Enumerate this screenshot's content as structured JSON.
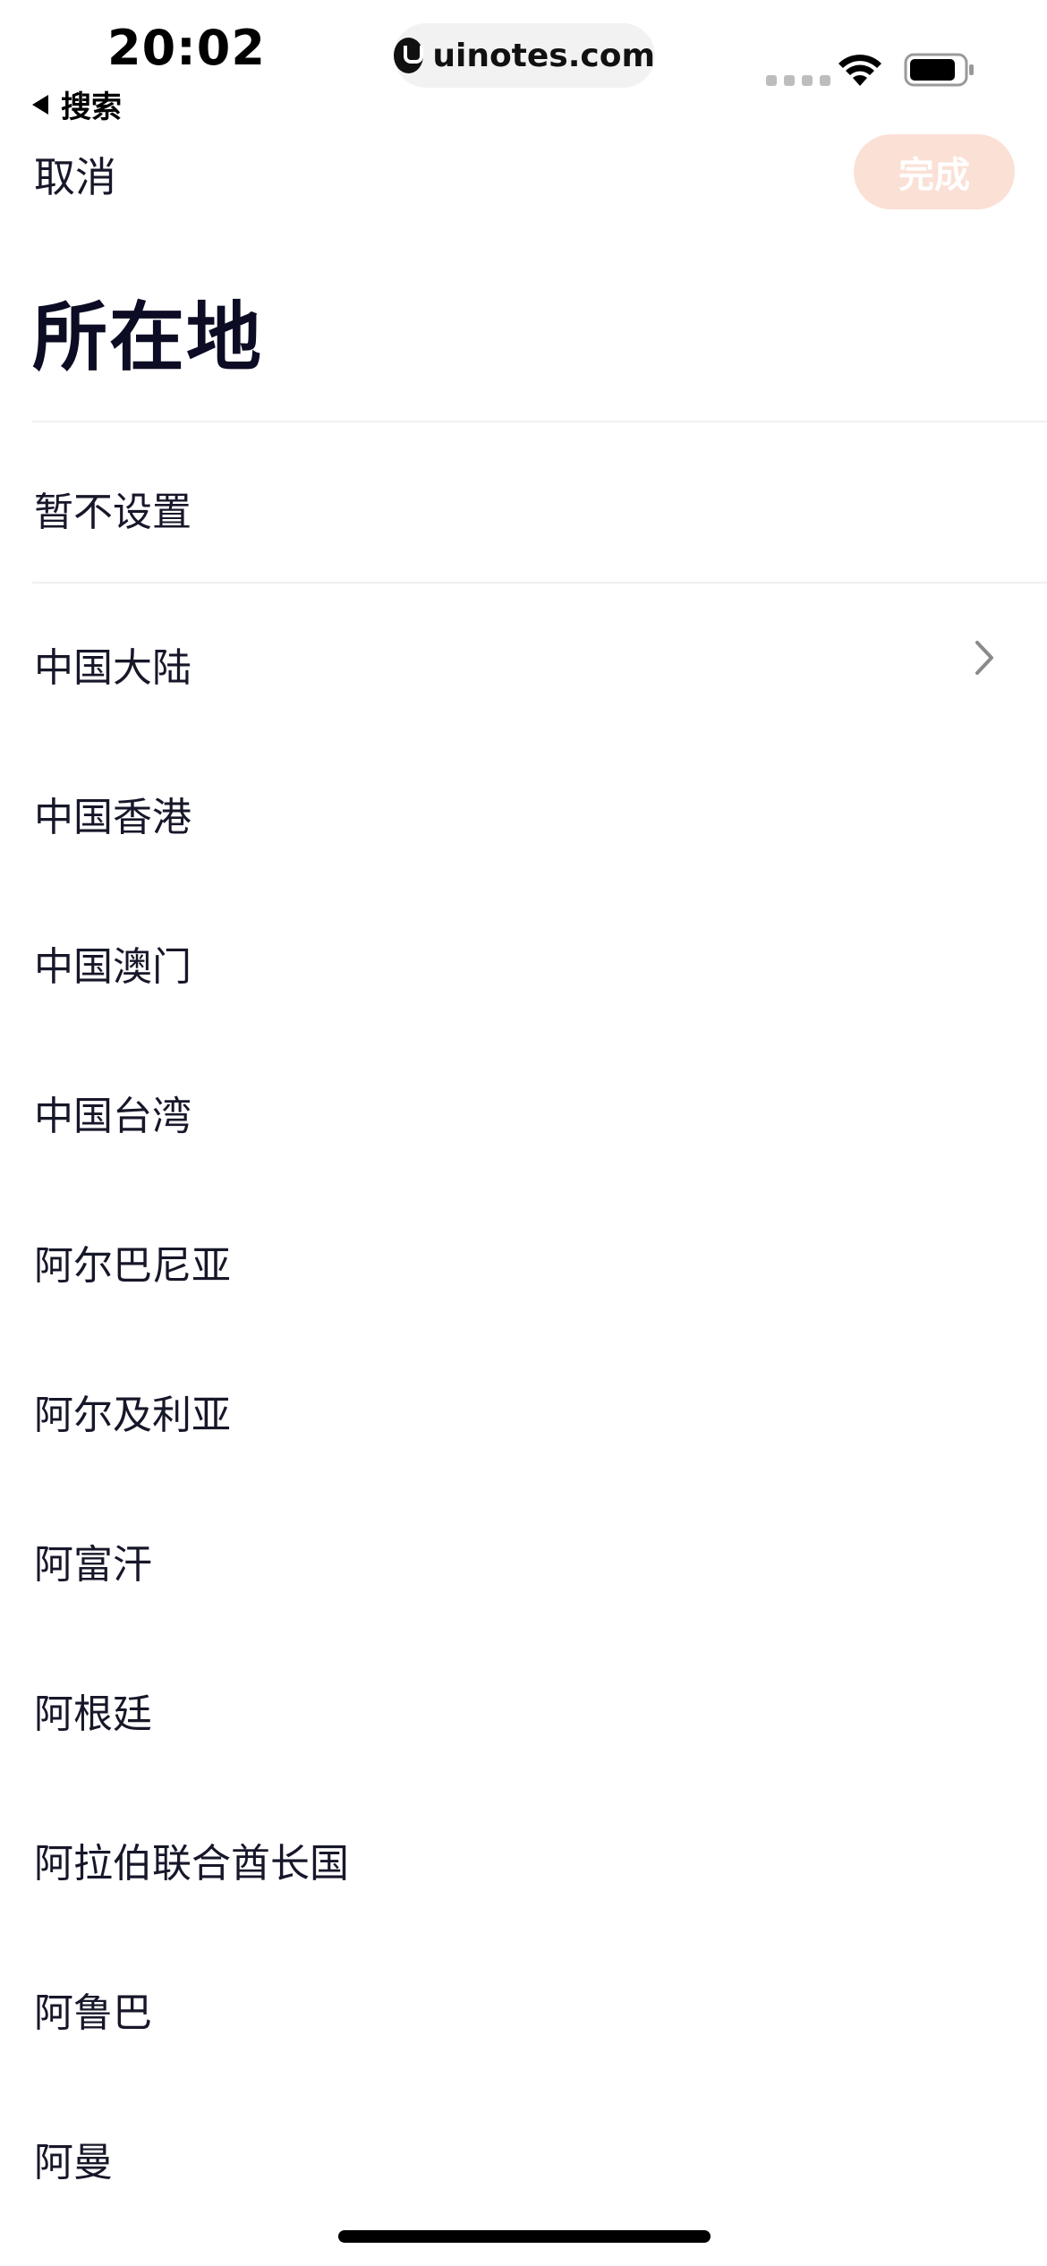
{
  "status_bar": {
    "time": "20:02",
    "back_label": "搜索",
    "url": "uinotes.com"
  },
  "nav": {
    "cancel_label": "取消",
    "done_label": "完成",
    "done_color": "#fbe0d6"
  },
  "page_title": "所在地",
  "not_set_label": "暂不设置",
  "regions": [
    {
      "label": "中国大陆",
      "has_chevron": true
    },
    {
      "label": "中国香港"
    },
    {
      "label": "中国澳门"
    },
    {
      "label": "中国台湾"
    },
    {
      "label": "阿尔巴尼亚"
    },
    {
      "label": "阿尔及利亚"
    },
    {
      "label": "阿富汗"
    },
    {
      "label": "阿根廷"
    },
    {
      "label": "阿拉伯联合酋长国"
    },
    {
      "label": "阿鲁巴"
    },
    {
      "label": "阿曼"
    }
  ]
}
